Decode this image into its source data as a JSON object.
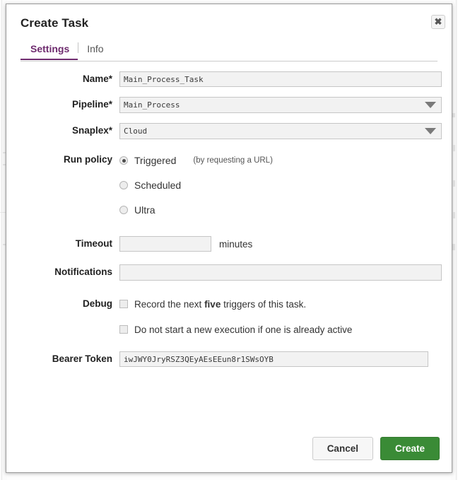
{
  "dialog": {
    "title": "Create Task",
    "close_label": "✖",
    "tabs": [
      {
        "label": "Settings",
        "active": true
      },
      {
        "label": "Info",
        "active": false
      }
    ]
  },
  "form": {
    "name": {
      "label": "Name*",
      "value": "Main_Process_Task",
      "placeholder": ""
    },
    "pipeline": {
      "label": "Pipeline*",
      "value": "Main_Process",
      "placeholder": ""
    },
    "snaplex": {
      "label": "Snaplex*",
      "value": "Cloud",
      "placeholder": ""
    },
    "run_policy": {
      "label": "Run policy",
      "options": [
        {
          "label": "Triggered",
          "hint": "(by requesting a URL)",
          "selected": true
        },
        {
          "label": "Scheduled",
          "hint": "",
          "selected": false
        },
        {
          "label": "Ultra",
          "hint": "",
          "selected": false
        }
      ]
    },
    "timeout": {
      "label": "Timeout",
      "value": "",
      "placeholder": "",
      "unit": "minutes"
    },
    "notifications": {
      "label": "Notifications",
      "value": "",
      "placeholder": ""
    },
    "debug": {
      "label": "Debug",
      "options": [
        {
          "text_before": "Record the next ",
          "text_bold": "five",
          "text_after": " triggers of this task.",
          "checked": false
        },
        {
          "text_before": "Do not start a new execution if one is already active",
          "text_bold": "",
          "text_after": "",
          "checked": false
        }
      ]
    },
    "bearer_token": {
      "label": "Bearer Token",
      "value": "iwJWY0JryRSZ3QEyAEsEEun8r1SWsOYB",
      "placeholder": ""
    }
  },
  "footer": {
    "cancel_label": "Cancel",
    "create_label": "Create"
  },
  "colors": {
    "accent_purple": "#6e2b6e",
    "create_green": "#3a8b36",
    "input_bg": "#f2f2f2",
    "border_gray": "#c6c6c6"
  }
}
